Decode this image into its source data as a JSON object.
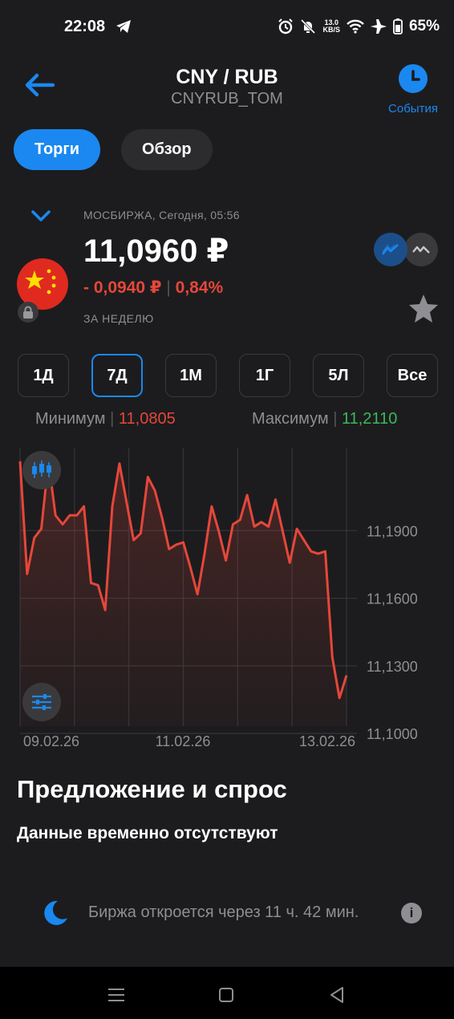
{
  "status": {
    "time": "22:08",
    "speed_top": "13.0",
    "speed_bottom": "KB/S",
    "battery": "65%",
    "icons": [
      "telegram-icon",
      "alarm-icon",
      "mute-icon",
      "wifi-icon",
      "airplane-icon",
      "battery-icon"
    ]
  },
  "header": {
    "title": "CNY / RUB",
    "subtitle": "CNYRUB_TOM",
    "events_label": "События"
  },
  "tabs": [
    {
      "label": "Торги",
      "active": true
    },
    {
      "label": "Обзор",
      "active": false
    }
  ],
  "quote": {
    "exchange": "МОСБИРЖА, Сегодня, 05:56",
    "price": "11,0960 ₽",
    "change_abs": "- 0,0940 ₽",
    "change_pct": "0,84%",
    "period": "ЗА НЕДЕЛЮ"
  },
  "ranges": [
    {
      "label": "1Д",
      "active": false
    },
    {
      "label": "7Д",
      "active": true
    },
    {
      "label": "1М",
      "active": false
    },
    {
      "label": "1Г",
      "active": false
    },
    {
      "label": "5Л",
      "active": false
    },
    {
      "label": "Все",
      "active": false
    }
  ],
  "stats": {
    "min_label": "Минимум",
    "min_value": "11,0805",
    "max_label": "Максимум",
    "max_value": "11,2110"
  },
  "chart_data": {
    "type": "line",
    "y_ticks": [
      11.19,
      11.16,
      11.13,
      11.1
    ],
    "y_tick_labels": [
      "11,1900",
      "11,1600",
      "11,1300",
      "11,1000"
    ],
    "x_tick_labels": [
      "09.02.26",
      "11.02.26",
      "13.02.26"
    ],
    "ylim": [
      11.073,
      11.1965
    ],
    "grid": true,
    "line_color": "#e5473a",
    "values": [
      11.1905,
      11.1405,
      11.1565,
      11.1605,
      11.1905,
      11.1665,
      11.1625,
      11.1665,
      11.1665,
      11.1705,
      11.1365,
      11.1355,
      11.1245,
      11.1705,
      11.1895,
      11.1725,
      11.1555,
      11.1585,
      11.1835,
      11.1775,
      11.1655,
      11.1515,
      11.1535,
      11.1545,
      11.1435,
      11.1315,
      11.1495,
      11.1705,
      11.1595,
      11.1465,
      11.1625,
      11.1645,
      11.1755,
      11.1615,
      11.1635,
      11.1615,
      11.1735,
      11.1595,
      11.1455,
      11.1605,
      11.1555,
      11.1505,
      11.1495,
      11.1505,
      11.1035,
      11.0855,
      11.0955
    ]
  },
  "orderbook": {
    "title": "Предложение и спрос",
    "empty": "Данные временно отсутствуют"
  },
  "market_status": {
    "text": "Биржа откроется через 11 ч. 42 мин."
  }
}
